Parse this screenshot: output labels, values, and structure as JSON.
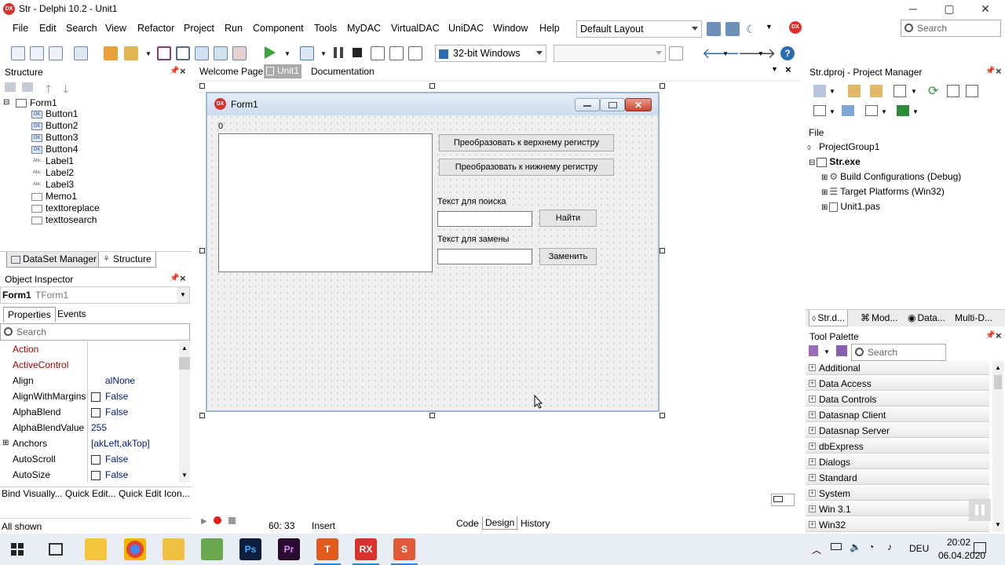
{
  "window": {
    "title": "Str - Delphi 10.2 - Unit1",
    "min": "─",
    "max": "▢",
    "close": "✕"
  },
  "menu": [
    "File",
    "Edit",
    "Search",
    "View",
    "Refactor",
    "Project",
    "Run",
    "Component",
    "Tools",
    "MyDAC",
    "VirtualDAC",
    "UniDAC",
    "Window",
    "Help"
  ],
  "layout_combo": "Default Layout",
  "top_search": "Search",
  "platform_combo": "32-bit Windows",
  "structure": {
    "title": "Structure",
    "root": "Form1",
    "items": [
      "Button1",
      "Button2",
      "Button3",
      "Button4",
      "Label1",
      "Label2",
      "Label3",
      "Memo1",
      "texttoreplace",
      "texttosearch"
    ],
    "item_icons": [
      "OK",
      "OK",
      "OK",
      "OK",
      "Abc",
      "Abc",
      "Abc",
      "",
      "",
      ""
    ],
    "tabs": [
      "DataSet Manager",
      "Structure"
    ]
  },
  "inspector": {
    "title": "Object Inspector",
    "object": "Form1",
    "class": "TForm1",
    "tabs": [
      "Properties",
      "Events"
    ],
    "search": "Search",
    "props": [
      {
        "name": "Action",
        "value": "",
        "red": true
      },
      {
        "name": "ActiveControl",
        "value": "",
        "red": true
      },
      {
        "name": "Align",
        "value": "alNone"
      },
      {
        "name": "AlignWithMargins",
        "value": "False",
        "cb": true
      },
      {
        "name": "AlphaBlend",
        "value": "False",
        "cb": true
      },
      {
        "name": "AlphaBlendValue",
        "value": "255"
      },
      {
        "name": "Anchors",
        "value": "[akLeft,akTop]",
        "exp": true
      },
      {
        "name": "AutoScroll",
        "value": "False",
        "cb": true
      },
      {
        "name": "AutoSize",
        "value": "False",
        "cb": true
      }
    ],
    "footer": "Bind Visually...  Quick Edit...  Quick Edit Icon...",
    "status": "All shown"
  },
  "editor": {
    "tabs": [
      "Welcome Page",
      "Unit1",
      "Documentation"
    ],
    "position": "60:  33",
    "mode": "Insert",
    "bottom_tabs": [
      "Code",
      "Design",
      "History"
    ]
  },
  "form": {
    "caption": "Form1",
    "label0": "0",
    "btn_upper": "Преобразовать к верхнему регистру",
    "btn_lower": "Преобразовать к нижнему регистру",
    "lbl_search": "Текст для поиска",
    "btn_find": "Найти",
    "lbl_replace": "Текст для замены",
    "btn_replace": "Заменить"
  },
  "project": {
    "title": "Str.dproj - Project Manager",
    "file_label": "File",
    "group": "ProjectGroup1",
    "exe": "Str.exe",
    "children": [
      "Build Configurations (Debug)",
      "Target Platforms (Win32)",
      "Unit1.pas"
    ],
    "tabs": [
      "Str.d...",
      "Mod...",
      "Data...",
      "Multi-D..."
    ]
  },
  "palette": {
    "title": "Tool Palette",
    "search": "Search",
    "groups": [
      "Additional",
      "Data Access",
      "Data Controls",
      "Datasnap Client",
      "Datasnap Server",
      "dbExpress",
      "Dialogs",
      "Standard",
      "System",
      "Win 3.1",
      "Win32"
    ]
  },
  "taskbar": {
    "time": "20:02",
    "date": "06.04.2020",
    "lang": "DEU",
    "apps": [
      "Ps",
      "Pr",
      "T",
      "RX",
      "S"
    ]
  }
}
